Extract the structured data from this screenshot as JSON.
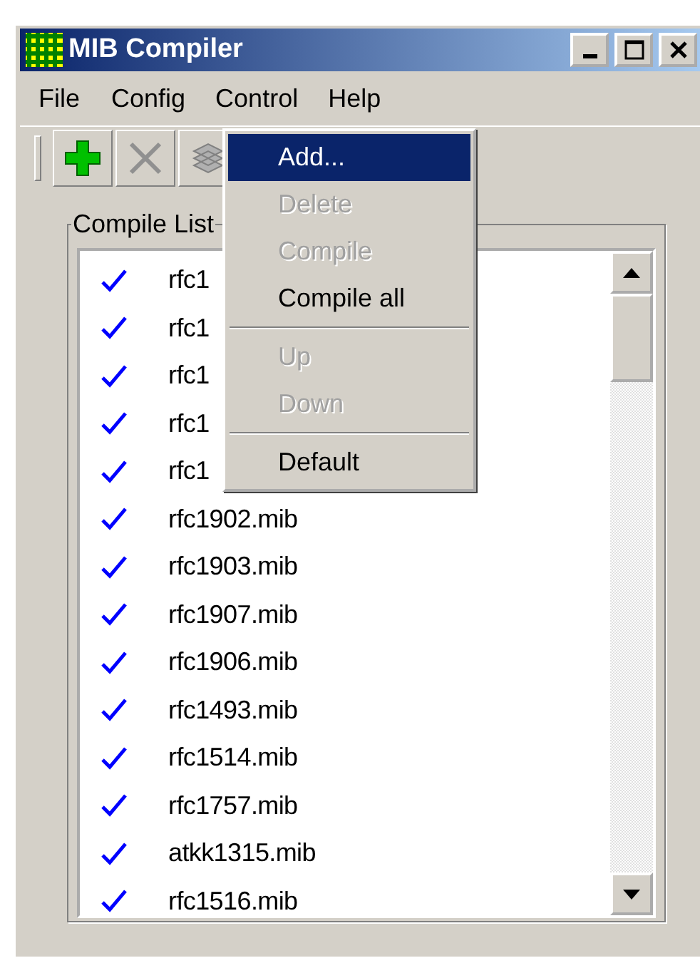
{
  "window": {
    "title": "MIB Compiler"
  },
  "menu_bar": [
    {
      "label": "File",
      "selected": false
    },
    {
      "label": "Config",
      "selected": false
    },
    {
      "label": "Control",
      "selected": true
    },
    {
      "label": "Help",
      "selected": false
    }
  ],
  "toolbar": [
    {
      "kind": "add",
      "disabled": false
    },
    {
      "kind": "delete",
      "disabled": true
    },
    {
      "kind": "compile",
      "disabled": true
    }
  ],
  "group": {
    "title": "Compile List"
  },
  "list": [
    {
      "name": "rfc1",
      "checked": true
    },
    {
      "name": "rfc1",
      "checked": true
    },
    {
      "name": "rfc1",
      "checked": true
    },
    {
      "name": "rfc1",
      "checked": true
    },
    {
      "name": "rfc1",
      "checked": true
    },
    {
      "name": "rfc1902.mib",
      "checked": true
    },
    {
      "name": "rfc1903.mib",
      "checked": true
    },
    {
      "name": "rfc1907.mib",
      "checked": true
    },
    {
      "name": "rfc1906.mib",
      "checked": true
    },
    {
      "name": "rfc1493.mib",
      "checked": true
    },
    {
      "name": "rfc1514.mib",
      "checked": true
    },
    {
      "name": "rfc1757.mib",
      "checked": true
    },
    {
      "name": "atkk1315.mib",
      "checked": true
    },
    {
      "name": "rfc1516.mib",
      "checked": true
    }
  ],
  "dropdown": [
    {
      "kind": "item",
      "label": "Add...",
      "selected": true,
      "disabled": false
    },
    {
      "kind": "item",
      "label": "Delete",
      "selected": false,
      "disabled": true
    },
    {
      "kind": "item",
      "label": "Compile",
      "selected": false,
      "disabled": true
    },
    {
      "kind": "item",
      "label": "Compile all",
      "selected": false,
      "disabled": false
    },
    {
      "kind": "separator"
    },
    {
      "kind": "item",
      "label": "Up",
      "selected": false,
      "disabled": true
    },
    {
      "kind": "item",
      "label": "Down",
      "selected": false,
      "disabled": true
    },
    {
      "kind": "separator"
    },
    {
      "kind": "item",
      "label": "Default",
      "selected": false,
      "disabled": false
    }
  ]
}
